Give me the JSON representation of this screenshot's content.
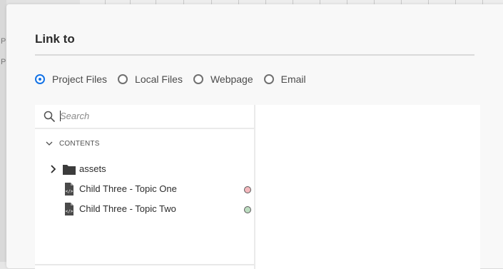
{
  "dialog": {
    "title": "Link to"
  },
  "link_type": {
    "options": [
      {
        "label": "Project Files",
        "selected": true
      },
      {
        "label": "Local Files",
        "selected": false
      },
      {
        "label": "Webpage",
        "selected": false
      },
      {
        "label": "Email",
        "selected": false
      }
    ]
  },
  "search": {
    "placeholder": "Search",
    "value": ""
  },
  "tree": {
    "section_label": "CONTENTS",
    "items": [
      {
        "label": "assets",
        "icon": "folder-icon",
        "expandable": true
      },
      {
        "label": "Child Three - Topic One",
        "icon": "topic-file-icon",
        "status_color": "#f4b8bd"
      },
      {
        "label": "Child Three - Topic Two",
        "icon": "topic-file-icon",
        "status_color": "#bcdcc0"
      }
    ]
  },
  "background": {
    "side_letters": [
      "P",
      "P"
    ]
  },
  "colors": {
    "accent": "#1473e6",
    "dialog_bg": "#f8f8f8",
    "pane_bg": "#ffffff"
  }
}
